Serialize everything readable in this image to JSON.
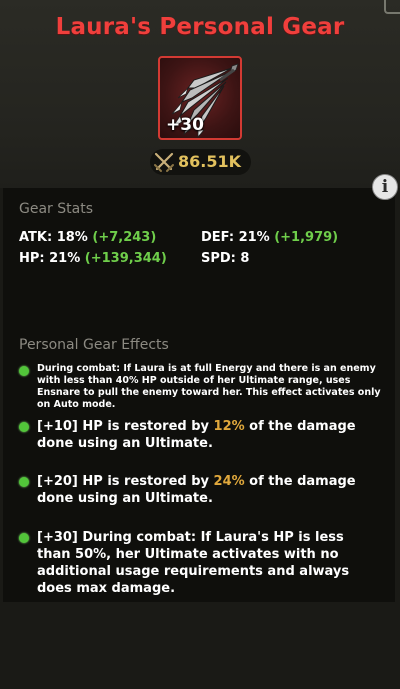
{
  "header": {
    "title": "Laura's Personal Gear",
    "gear_level": "+30",
    "power_value": "86.51K"
  },
  "gear_stats": {
    "section_title": "Gear Stats",
    "atk": {
      "label": "ATK: 18%",
      "bonus": "(+7,243)"
    },
    "def": {
      "label": "DEF: 21%",
      "bonus": "(+1,979)"
    },
    "hp": {
      "label": "HP: 21%",
      "bonus": "(+139,344)"
    },
    "spd": {
      "label": "SPD: 8"
    }
  },
  "effects": {
    "section_title": "Personal Gear Effects",
    "e0": {
      "text": "During combat: If Laura is at full Energy and there is an enemy with less than 40% HP outside of her Ultimate range, uses Ensnare to pull the enemy toward her. This effect activates only on Auto mode."
    },
    "e1": {
      "pre": "[+10] HP is restored by ",
      "pct": "12%",
      "post": " of the damage done using an Ultimate."
    },
    "e2": {
      "pre": "[+20] HP is restored by ",
      "pct": "24%",
      "post": " of the damage done using an Ultimate."
    },
    "e3": {
      "text": "[+30] During combat: If Laura's HP is less than 50%, her Ultimate activates with no additional usage requirements and always does max damage."
    }
  },
  "info_button": {
    "glyph": "i"
  },
  "colors": {
    "title": "#f03f3c",
    "gear_border": "#d33a33",
    "stat_bonus": "#6fce4b",
    "effect_bullet": "#52c53a",
    "percent_highlight": "#e0a83c",
    "power": "#e2c15e"
  },
  "icons": [
    "gear-claws-icon",
    "crossed-swords-icon",
    "info-icon",
    "bullet-dot-icon"
  ]
}
